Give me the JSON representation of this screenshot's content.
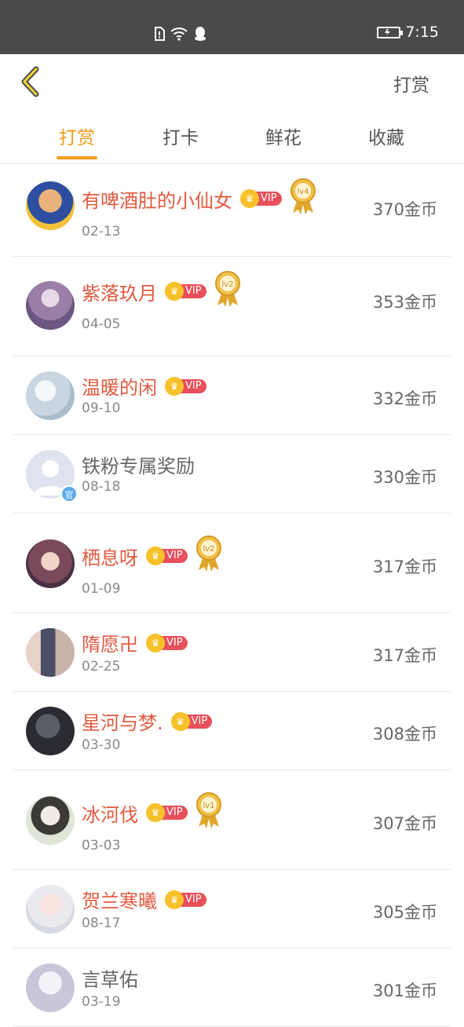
{
  "status_bar": {
    "time": "7:15"
  },
  "header": {
    "right_label": "打赏"
  },
  "tabs": [
    {
      "label": "打赏"
    },
    {
      "label": "打卡"
    },
    {
      "label": "鲜花"
    },
    {
      "label": "收藏"
    }
  ],
  "rows": [
    {
      "name": "有啤酒肚的小仙女",
      "vip": "VIP",
      "medal": "lv4",
      "date": "02-13",
      "coins": "370金币"
    },
    {
      "name": "紫落玖月",
      "vip": "VIP",
      "medal": "lv2",
      "date": "04-05",
      "coins": "353金币"
    },
    {
      "name": "温暖的闲",
      "vip": "VIP",
      "medal": "",
      "date": "09-10",
      "coins": "332金币"
    },
    {
      "name": "铁粉专属奖励",
      "vip": "",
      "medal": "",
      "date": "08-18",
      "coins": "330金币",
      "official_badge": "官"
    },
    {
      "name": "栖息呀",
      "vip": "VIP",
      "medal": "lv2",
      "date": "01-09",
      "coins": "317金币"
    },
    {
      "name": "隋愿卍",
      "vip": "VIP",
      "medal": "",
      "date": "02-25",
      "coins": "317金币"
    },
    {
      "name": "星河与梦.",
      "vip": "VIP",
      "medal": "",
      "date": "03-30",
      "coins": "308金币"
    },
    {
      "name": "冰河伐",
      "vip": "VIP",
      "medal": "lv1",
      "date": "03-03",
      "coins": "307金币"
    },
    {
      "name": "贺兰寒曦",
      "vip": "VIP",
      "medal": "",
      "date": "08-17",
      "coins": "305金币"
    },
    {
      "name": "言草佑",
      "vip": "",
      "medal": "",
      "date": "03-19",
      "coins": "301金币"
    }
  ],
  "colors": {
    "accent": "#f29b18",
    "name_red": "#e05a40",
    "vip_red": "#e8505b",
    "vip_gold": "#f6c12a"
  }
}
